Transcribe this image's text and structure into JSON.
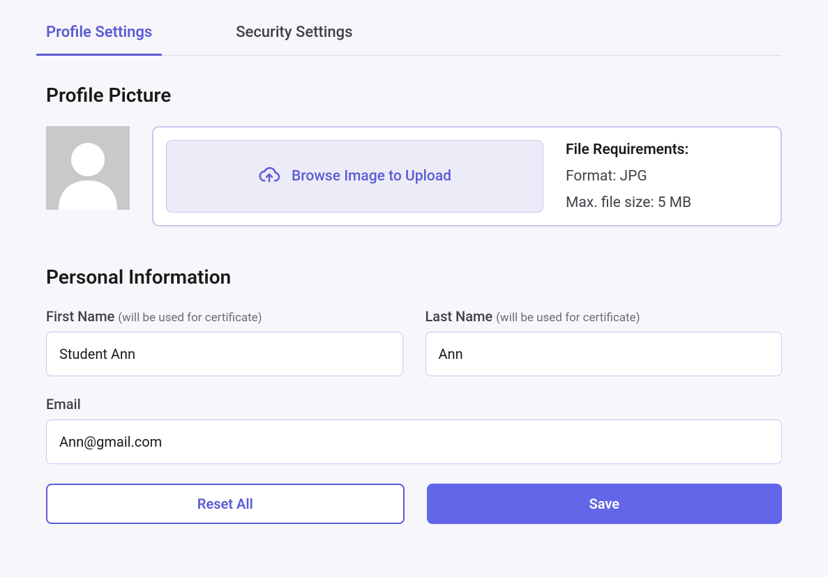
{
  "tabs": {
    "profile": "Profile Settings",
    "security": "Security Settings"
  },
  "picture": {
    "heading": "Profile Picture",
    "browse_label": "Browse Image to Upload",
    "requirements_title": "File Requirements:",
    "format_line": "Format: JPG",
    "size_line": "Max. file size: 5 MB"
  },
  "personal": {
    "heading": "Personal Information",
    "first_name_label": "First Name",
    "first_name_hint": "(will be used for certificate)",
    "first_name_value": "Student Ann",
    "last_name_label": "Last Name",
    "last_name_hint": "(will be used for certificate)",
    "last_name_value": "Ann",
    "email_label": "Email",
    "email_value": "Ann@gmail.com"
  },
  "buttons": {
    "reset": "Reset All",
    "save": "Save"
  }
}
